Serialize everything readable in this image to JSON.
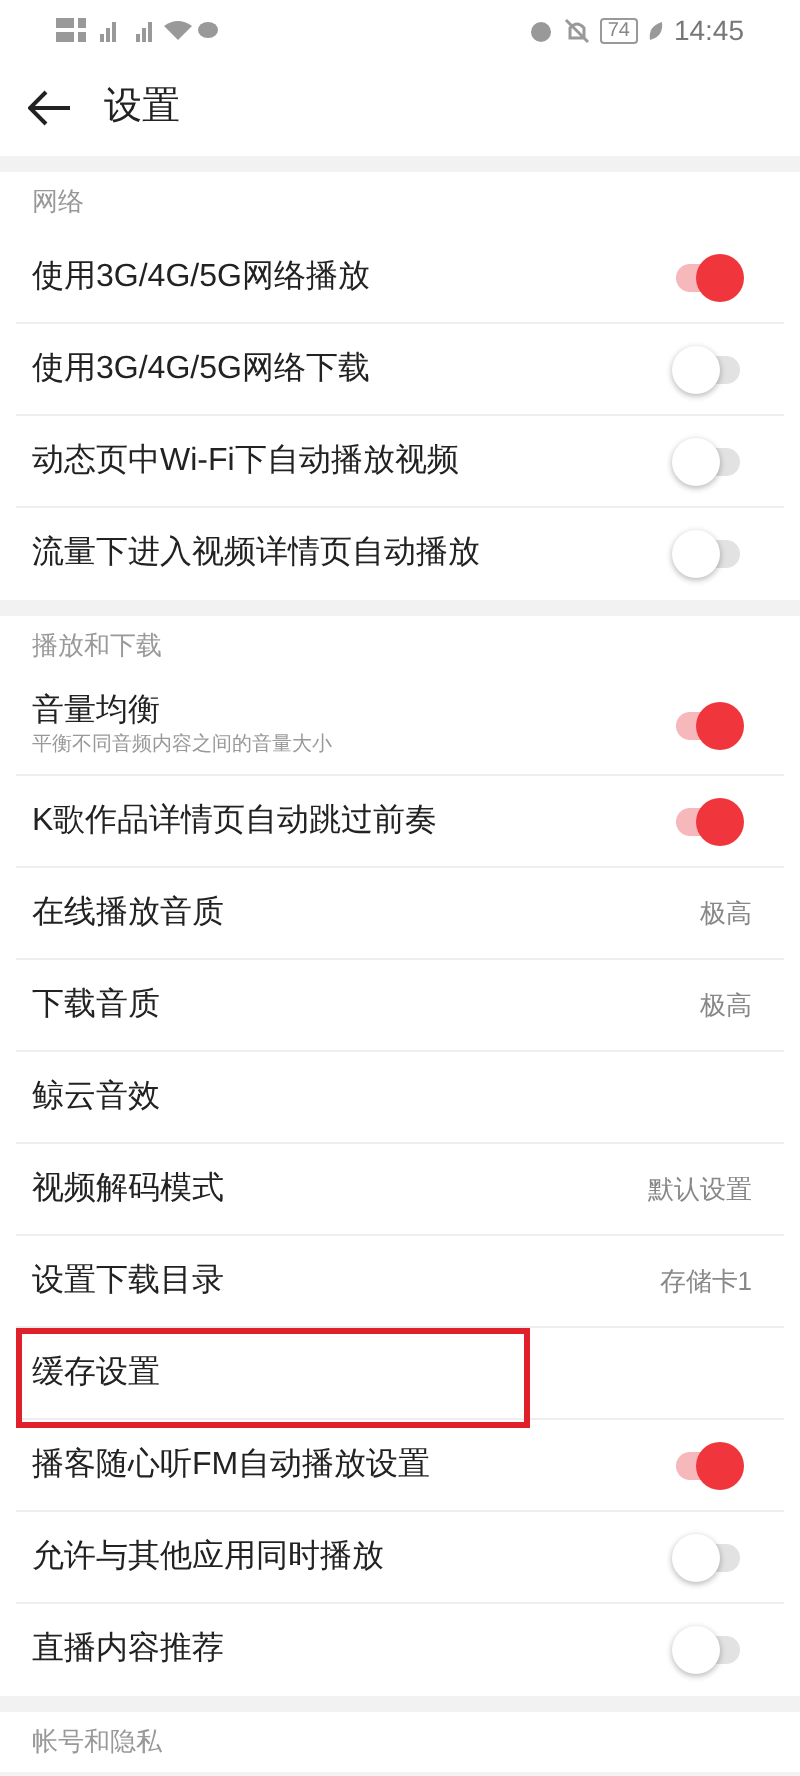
{
  "status_bar": {
    "battery": "74",
    "time": "14:45"
  },
  "header": {
    "title": "设置"
  },
  "sections": [
    {
      "title": "网络",
      "rows": [
        {
          "kind": "toggle",
          "label": "使用3G/4G/5G网络播放",
          "on": true
        },
        {
          "kind": "toggle",
          "label": "使用3G/4G/5G网络下载",
          "on": false
        },
        {
          "kind": "toggle",
          "label": "动态页中Wi-Fi下自动播放视频",
          "on": false
        },
        {
          "kind": "toggle",
          "label": "流量下进入视频详情页自动播放",
          "on": false
        }
      ]
    },
    {
      "title": "播放和下载",
      "rows": [
        {
          "kind": "toggle",
          "label": "音量均衡",
          "subtitle": "平衡不同音频内容之间的音量大小",
          "on": true
        },
        {
          "kind": "toggle",
          "label": "K歌作品详情页自动跳过前奏",
          "on": true
        },
        {
          "kind": "value",
          "label": "在线播放音质",
          "value": "极高"
        },
        {
          "kind": "value",
          "label": "下载音质",
          "value": "极高"
        },
        {
          "kind": "link",
          "label": "鲸云音效"
        },
        {
          "kind": "value",
          "label": "视频解码模式",
          "value": "默认设置"
        },
        {
          "kind": "value",
          "label": "设置下载目录",
          "value": "存储卡1"
        },
        {
          "kind": "link",
          "label": "缓存设置",
          "highlighted": true
        },
        {
          "kind": "toggle",
          "label": "播客随心听FM自动播放设置",
          "on": true
        },
        {
          "kind": "toggle",
          "label": "允许与其他应用同时播放",
          "on": false
        },
        {
          "kind": "toggle",
          "label": "直播内容推荐",
          "on": false
        }
      ]
    },
    {
      "title": "帐号和隐私"
    }
  ]
}
